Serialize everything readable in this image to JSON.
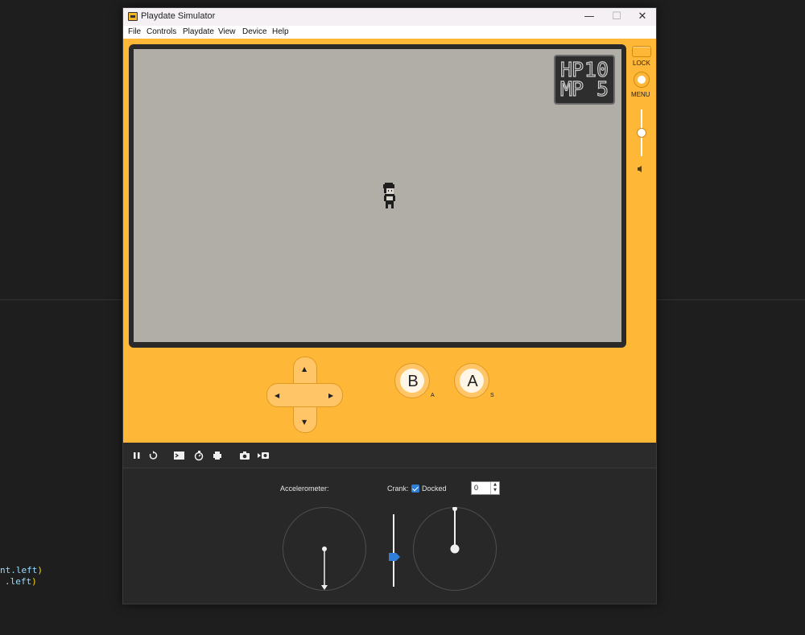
{
  "window": {
    "title": "Playdate Simulator",
    "controls": {
      "minimize": "—",
      "maximize": "☐",
      "close": "✕"
    }
  },
  "menu": {
    "items": [
      "File",
      "Controls",
      "Playdate",
      "View",
      "Device",
      "Help"
    ]
  },
  "game": {
    "hud": {
      "hp_label": "HP",
      "hp_value": "10",
      "mp_label": "MP",
      "mp_value": "5"
    },
    "screen_color": "#b1aea7"
  },
  "device": {
    "lock_label": "LOCK",
    "menu_label": "MENU",
    "volume": 0.5,
    "b_label": "B",
    "b_key": "A",
    "a_label": "A",
    "a_key": "S",
    "dpad": {
      "up": "▲",
      "down": "▼",
      "left": "◀",
      "right": "▶"
    },
    "body_color": "#ffb738"
  },
  "toolbar": {
    "icons": [
      "pause-icon",
      "restart-icon",
      "console-icon",
      "stopwatch-icon",
      "printer-icon",
      "camera-icon",
      "record-video-icon"
    ]
  },
  "controls_panel": {
    "accelerometer_label": "Accelerometer:",
    "crank_label": "Crank:",
    "docked_label": "Docked",
    "docked_checked": true,
    "crank_angle": "0"
  },
  "background_code": {
    "line1_a": "nt.left",
    "line1_b": ")",
    "line2_a": ".left",
    "line2_b": ")"
  }
}
